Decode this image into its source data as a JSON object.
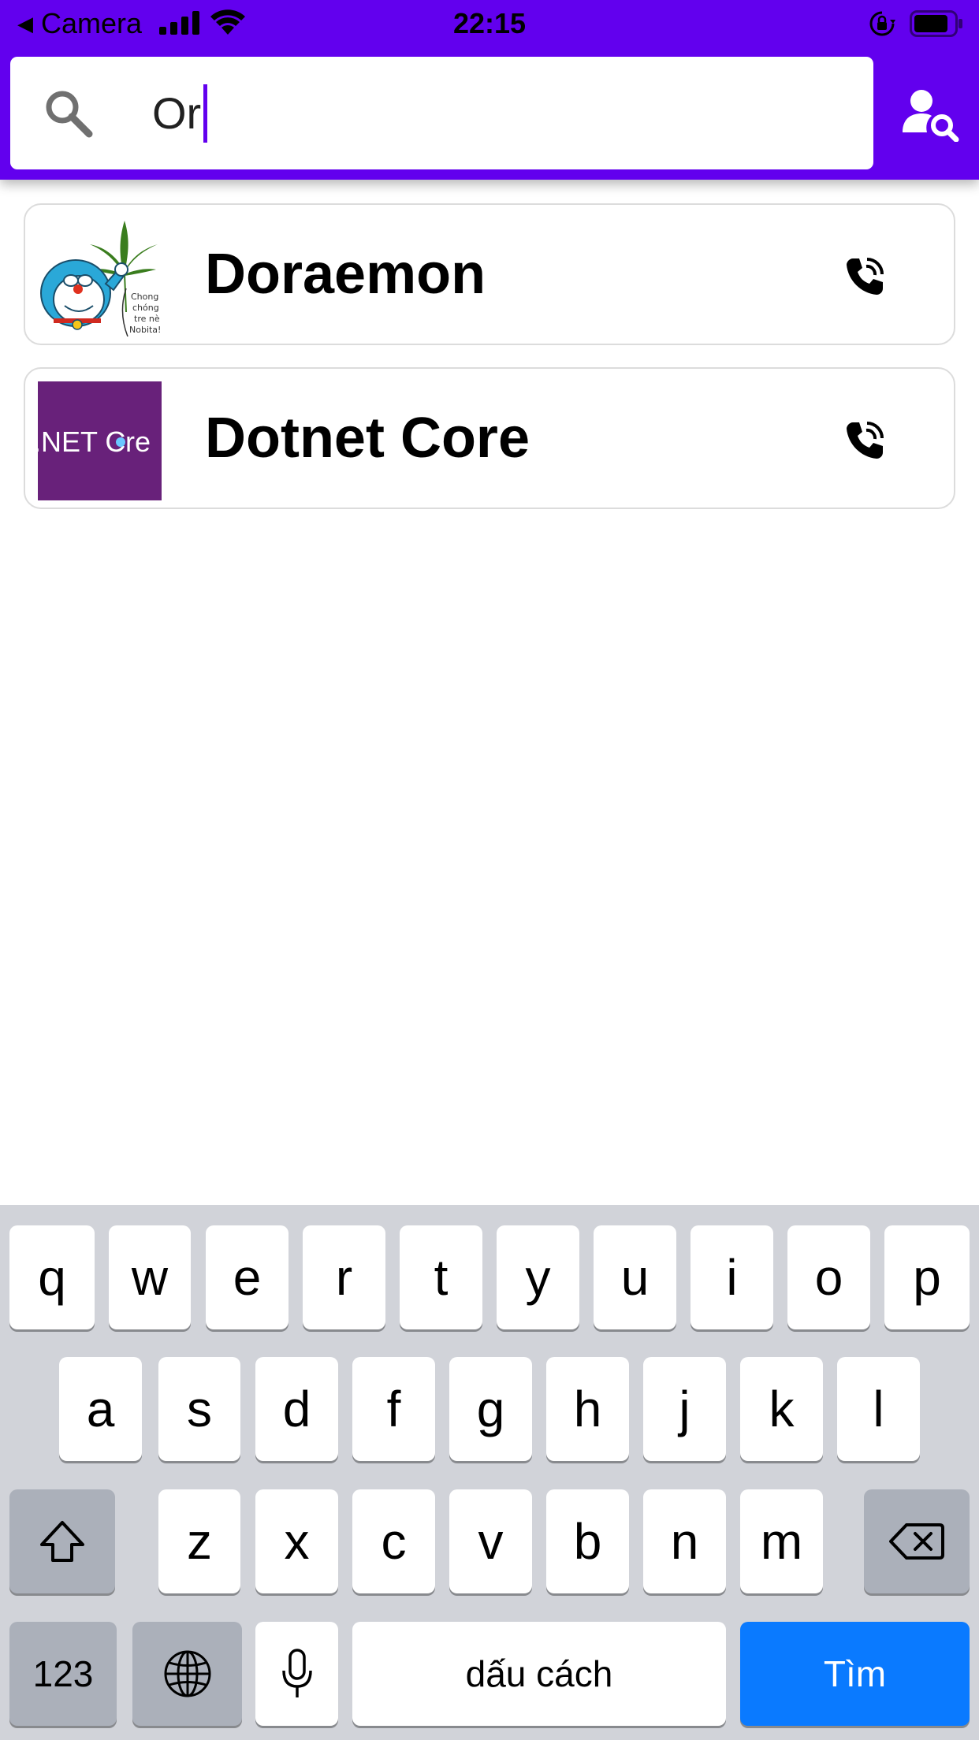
{
  "status_bar": {
    "back_label": "Camera",
    "time": "22:15"
  },
  "search": {
    "value": "Or"
  },
  "contacts": [
    {
      "name": "Doraemon",
      "avatar_caption": [
        "Chong",
        "chóng",
        "tre nè",
        "Nobita!"
      ]
    },
    {
      "name": "Dotnet Core",
      "avatar_caption": [
        ".NET C",
        "re"
      ]
    }
  ],
  "keyboard": {
    "row1": [
      "q",
      "w",
      "e",
      "r",
      "t",
      "y",
      "u",
      "i",
      "o",
      "p"
    ],
    "row2": [
      "a",
      "s",
      "d",
      "f",
      "g",
      "h",
      "j",
      "k",
      "l"
    ],
    "row3": [
      "z",
      "x",
      "c",
      "v",
      "b",
      "n",
      "m"
    ],
    "numbers_label": "123",
    "space_label": "dấu cách",
    "return_label": "Tìm"
  },
  "colors": {
    "primary": "#6200ee",
    "keyboard_bg": "#d1d3d9",
    "return_key": "#0a7aff",
    "dotnet_avatar": "#68217a"
  },
  "icons": [
    "search-icon",
    "person-search-icon",
    "phone-call-icon",
    "shift-icon",
    "backspace-icon",
    "globe-icon",
    "microphone-icon"
  ]
}
